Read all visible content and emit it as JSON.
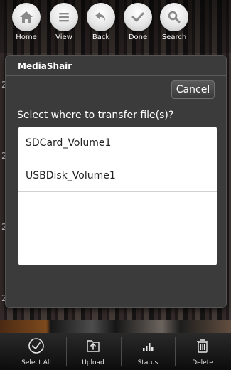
{
  "toolbar": {
    "home_label": "Home",
    "view_label": "View",
    "back_label": "Back",
    "done_label": "Done",
    "search_label": "Search"
  },
  "dialog": {
    "title": "MediaShair",
    "cancel_label": "Cancel",
    "prompt": "Select where to transfer file(s)?",
    "items": [
      {
        "label": "SDCard_Volume1"
      },
      {
        "label": "USBDisk_Volume1"
      }
    ]
  },
  "background": {
    "side_digits": [
      "2",
      "2",
      "2",
      "2"
    ]
  },
  "bottom_toolbar": {
    "select_all_label": "Select All",
    "upload_label": "Upload",
    "status_label": "Status",
    "delete_label": "Delete"
  },
  "icons": {
    "home": "home-icon",
    "view": "list-icon",
    "back": "undo-arrow-icon",
    "done": "checkmark-icon",
    "search": "magnifier-icon",
    "select_all": "check-circle-icon",
    "upload": "upload-folder-icon",
    "status": "bar-chart-icon",
    "delete": "trash-icon"
  },
  "colors": {
    "dialog_bg": "#3b3b3b",
    "list_bg": "#ffffff",
    "toolbar_text": "#ffffff"
  }
}
